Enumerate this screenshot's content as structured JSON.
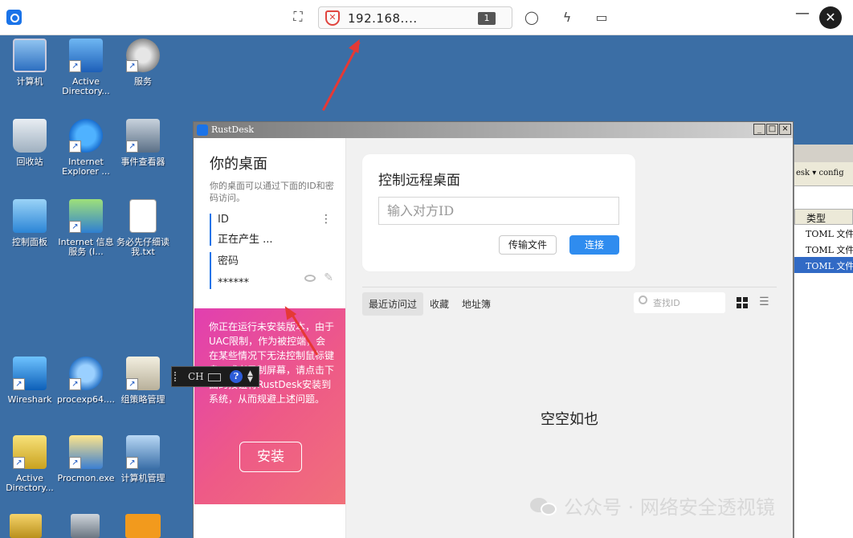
{
  "toolbar": {
    "address": "192.168....",
    "display_badge": "1",
    "icons": [
      "fullscreen-icon",
      "security-shield-icon",
      "chat-icon",
      "action-bolt-icon",
      "display-icon",
      "minimize-icon",
      "close-icon"
    ]
  },
  "desktop_icons": [
    {
      "label": "计算机",
      "icon": "computer-icon"
    },
    {
      "label": "Active Directory...",
      "icon": "active-directory-icon"
    },
    {
      "label": "服务",
      "icon": "services-gear-icon"
    },
    {
      "label": "回收站",
      "icon": "recycle-bin-icon"
    },
    {
      "label": "Internet Explorer ...",
      "icon": "internet-explorer-icon"
    },
    {
      "label": "事件查看器",
      "icon": "event-viewer-icon"
    },
    {
      "label": "控制面板",
      "icon": "control-panel-icon"
    },
    {
      "label": "Internet 信息服务 (I...",
      "icon": "iis-icon"
    },
    {
      "label": "务必先仔细读我.txt",
      "icon": "text-file-icon"
    },
    {
      "label": "Wireshark",
      "icon": "wireshark-icon"
    },
    {
      "label": "procexp64....",
      "icon": "procexp-icon"
    },
    {
      "label": "组策略管理",
      "icon": "group-policy-icon"
    },
    {
      "label": "Active Directory...",
      "icon": "active-directory-icon"
    },
    {
      "label": "Procmon.exe",
      "icon": "procmon-icon"
    },
    {
      "label": "计算机管理",
      "icon": "computer-management-icon"
    }
  ],
  "bg_window": {
    "toolbar_text": "esk ▾ config",
    "column_header": "类型",
    "rows": [
      "TOML 文件",
      "TOML 文件",
      "TOML 文件"
    ]
  },
  "rustdesk": {
    "title": "RustDesk",
    "window_buttons": [
      "_",
      "□",
      "×"
    ],
    "your_desktop": {
      "heading": "你的桌面",
      "description": "你的桌面可以通过下面的ID和密码访问。",
      "id_label": "ID",
      "id_value": "正在产生 ...",
      "password_label": "密码",
      "password_value": "******"
    },
    "promo": {
      "text": "你正在运行未安装版本，由于UAC限制，作为被控端，会在某些情况下无法控制鼠标键盘，或者录制屏幕，请点击下面的按钮将RustDesk安装到系统，从而规避上述问题。",
      "install_label": "安装"
    },
    "remote_card": {
      "title": "控制远程桌面",
      "id_placeholder": "输入对方ID",
      "transfer_label": "传输文件",
      "connect_label": "连接"
    },
    "tabs": [
      "最近访问过",
      "收藏",
      "地址簿"
    ],
    "search_placeholder": "查找ID",
    "empty_text": "空空如也"
  },
  "language_bar": {
    "code": "CH",
    "help": "?"
  },
  "watermark": "公众号 · 网络安全透视镜"
}
